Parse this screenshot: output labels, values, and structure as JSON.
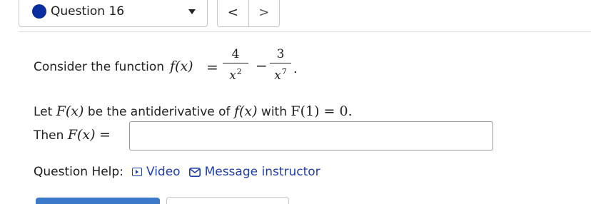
{
  "question_selector": {
    "label": "Question 16",
    "status_icon": "filled-circle-icon",
    "dropdown_icon": "caret-down-icon"
  },
  "navigation": {
    "prev_label": "<",
    "next_label": ">"
  },
  "problem": {
    "intro_text": "Consider the function",
    "f_of_x": "f(x)",
    "equals": "=",
    "term1": {
      "numerator": "4",
      "denominator_base": "x",
      "denominator_exp": "2"
    },
    "minus": "−",
    "term2": {
      "numerator": "3",
      "denominator_base": "x",
      "denominator_exp": "7"
    },
    "period": ".",
    "line2_a": "Let",
    "line2_F": "F(x)",
    "line2_b": "be the antiderivative of",
    "line2_f": "f(x)",
    "line2_c": "with",
    "line2_cond": "F(1) = 0.",
    "then_text": "Then",
    "then_F": "F(x)",
    "then_eq": "="
  },
  "answer": {
    "value": "",
    "placeholder": ""
  },
  "help": {
    "label": "Question Help:",
    "video_label": "Video",
    "video_icon": "video-play-icon",
    "message_label": "Message instructor",
    "message_icon": "mail-icon",
    "link_color": "#1f3fa8"
  },
  "colors": {
    "status_dot": "#0b2e9e",
    "primary_button": "#3d79c9"
  }
}
